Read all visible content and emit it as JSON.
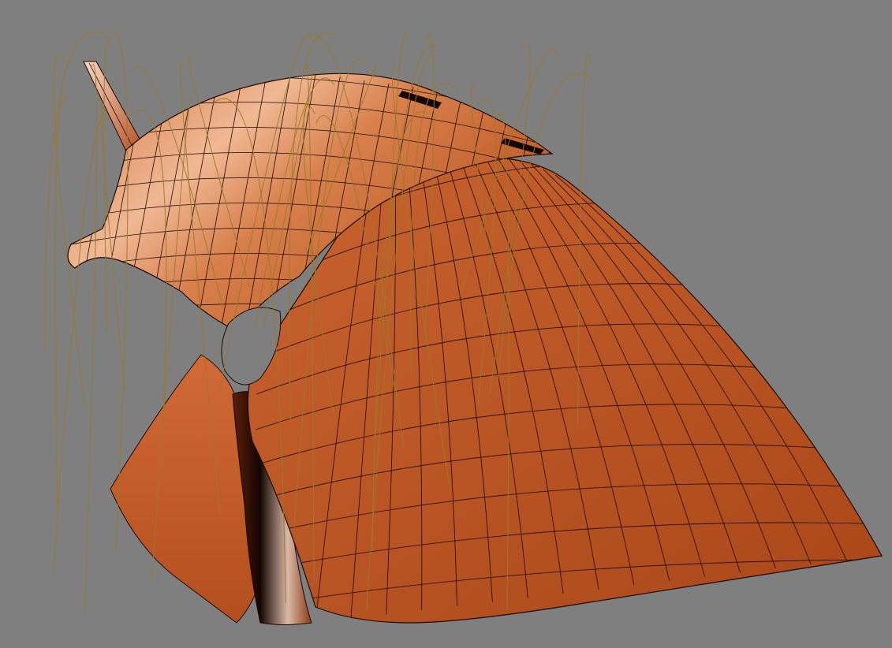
{
  "viewport": {
    "background_color": "#7f7f7f",
    "render_mode": "shaded-with-wireframe"
  },
  "model": {
    "description_icon": "mesh-surface-icon",
    "surface_color": "#c8622e",
    "surface_shadow_color": "#8a3a14",
    "surface_highlight_color": "#f2c7a8",
    "wireframe_color": "#1a0a04",
    "hair_curve_color": "#9a7a2a"
  }
}
